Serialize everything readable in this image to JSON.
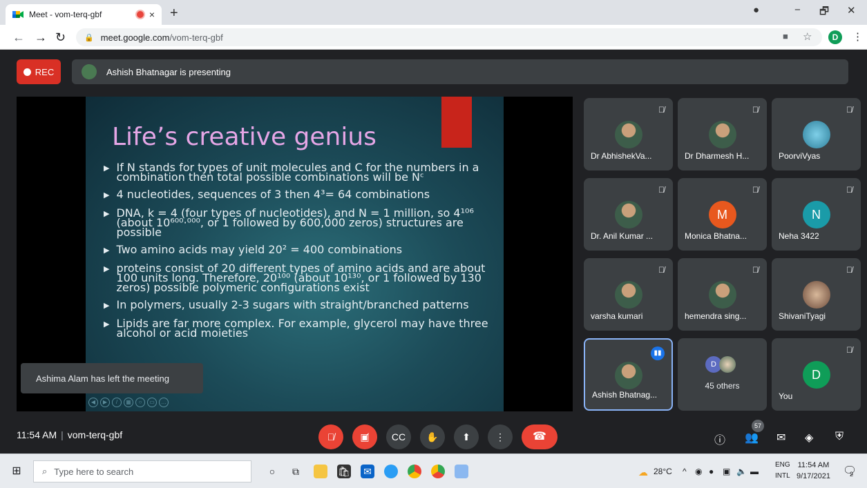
{
  "browser": {
    "tab_title": "Meet - vom-terq-gbf",
    "tab_close": "×",
    "new_tab": "+",
    "url_domain": "meet.google.com",
    "url_path": "/vom-terq-gbf",
    "profile_initial": "D",
    "minimize": "−",
    "maximize": "🗗",
    "close": "✕"
  },
  "meet": {
    "rec_label": "REC",
    "presenting_text": "Ashish Bhatnagar is presenting",
    "slide": {
      "title": "Life’s creative genius",
      "bullets": [
        "If N stands for types of unit molecules and C for the numbers in a combination then total possible combinations will be Nᶜ",
        "4 nucleotides, sequences of 3 then 4³= 64 combinations",
        "DNA, k = 4 (four types of nucleotides), and N = 1 million, so 4¹⁰⁶ (about 10⁶⁰⁰·⁰⁰⁰, or 1 followed by 600,000 zeros) structures are possible",
        "Two amino acids may yield 20² = 400 combinations",
        "proteins consist of 20 different types of amino acids and are about 100 units long. Therefore, 20¹⁰⁰ (about 10¹³⁰, or 1 followed by 130 zeros) possible polymeric configurations exist",
        "In polymers, usually 2-3 sugars with straight/branched patterns",
        "Lipids are far more complex. For example, glycerol may have three alcohol or acid moieties"
      ]
    },
    "toast": "Ashima Alam has left the meeting",
    "participants": [
      {
        "name": "Dr AbhishekVa...",
        "initial": "",
        "color": ""
      },
      {
        "name": "Dr Dharmesh H...",
        "initial": "",
        "color": ""
      },
      {
        "name": "PoorviVyas",
        "initial": "",
        "color": ""
      },
      {
        "name": "Dr. Anil Kumar ...",
        "initial": "",
        "color": ""
      },
      {
        "name": "Monica Bhatna...",
        "initial": "M",
        "color": "#e8581e"
      },
      {
        "name": "Neha 3422",
        "initial": "N",
        "color": "#1a9ba8"
      },
      {
        "name": "varsha kumari",
        "initial": "",
        "color": ""
      },
      {
        "name": "hemendra sing...",
        "initial": "",
        "color": ""
      },
      {
        "name": "ShivaniTyagi",
        "initial": "",
        "color": ""
      },
      {
        "name": "Ashish Bhatnag...",
        "initial": "",
        "color": ""
      }
    ],
    "others": {
      "label": "45 others",
      "initial": "D"
    },
    "self": {
      "name": "You",
      "initial": "D",
      "color": "#0f9d58"
    },
    "time": "11:54 AM",
    "meeting_code": "vom-terq-gbf",
    "participant_count": "57"
  },
  "taskbar": {
    "search_placeholder": "Type here to search",
    "weather": "28°C",
    "lang_top": "ENG",
    "lang_bottom": "INTL",
    "clock_time": "11:54 AM",
    "clock_date": "9/17/2021",
    "notif_count": "2"
  }
}
